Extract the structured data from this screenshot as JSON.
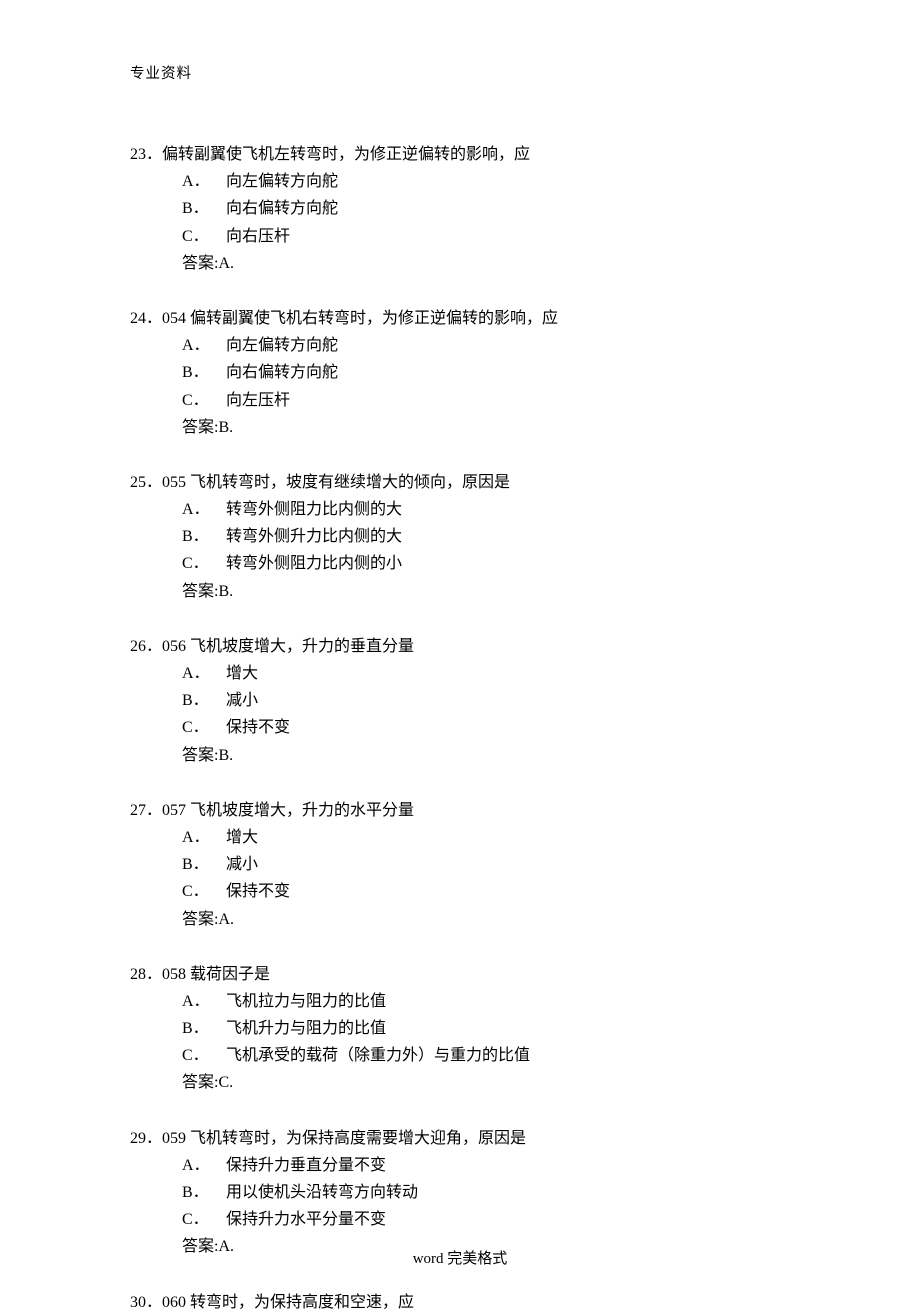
{
  "header": "专业资料",
  "footer_en": "word",
  "footer_cn": " 完美格式",
  "answer_prefix": "答案:",
  "questions": [
    {
      "num": "23．",
      "text": "偏转副翼使飞机左转弯时，为修正逆偏转的影响，应",
      "opts": [
        {
          "l": "A．",
          "t": "向左偏转方向舵"
        },
        {
          "l": "B．",
          "t": "向右偏转方向舵"
        },
        {
          "l": "C．",
          "t": "向右压杆"
        }
      ],
      "ans": "A."
    },
    {
      "num": "24．",
      "text": "054 偏转副翼使飞机右转弯时，为修正逆偏转的影响，应",
      "opts": [
        {
          "l": "A．",
          "t": "向左偏转方向舵"
        },
        {
          "l": "B．",
          "t": "向右偏转方向舵"
        },
        {
          "l": "C．",
          "t": "向左压杆"
        }
      ],
      "ans": "B."
    },
    {
      "num": "25．",
      "text": "055 飞机转弯时，坡度有继续增大的倾向，原因是",
      "opts": [
        {
          "l": "A．",
          "t": "转弯外侧阻力比内侧的大"
        },
        {
          "l": "B．",
          "t": "转弯外侧升力比内侧的大"
        },
        {
          "l": "C．",
          "t": "转弯外侧阻力比内侧的小"
        }
      ],
      "ans": "B."
    },
    {
      "num": "26．",
      "text": "056 飞机坡度增大，升力的垂直分量",
      "opts": [
        {
          "l": "A．",
          "t": "增大"
        },
        {
          "l": "B．",
          "t": "减小"
        },
        {
          "l": "C．",
          "t": "保持不变"
        }
      ],
      "ans": "B."
    },
    {
      "num": "27．",
      "text": "057 飞机坡度增大，升力的水平分量",
      "opts": [
        {
          "l": "A．",
          "t": "增大"
        },
        {
          "l": "B．",
          "t": "减小"
        },
        {
          "l": "C．",
          "t": "保持不变"
        }
      ],
      "ans": "A."
    },
    {
      "num": "28．",
      "text": "058 载荷因子是",
      "opts": [
        {
          "l": "A．",
          "t": "飞机拉力与阻力的比值"
        },
        {
          "l": "B．",
          "t": "飞机升力与阻力的比值"
        },
        {
          "l": "C．",
          "t": "飞机承受的载荷（除重力外）与重力的比值"
        }
      ],
      "ans": "C."
    },
    {
      "num": "29．",
      "text": "059 飞机转弯时，为保持高度需要增大迎角，原因是",
      "opts": [
        {
          "l": "A．",
          "t": "保持升力垂直分量不变"
        },
        {
          "l": "B．",
          "t": "用以使机头沿转弯方向转动"
        },
        {
          "l": "C．",
          "t": "保持升力水平分量不变"
        }
      ],
      "ans": "A."
    },
    {
      "num": "30．",
      "text": "060 转弯时，为保持高度和空速，应",
      "opts": [],
      "ans": null
    }
  ]
}
